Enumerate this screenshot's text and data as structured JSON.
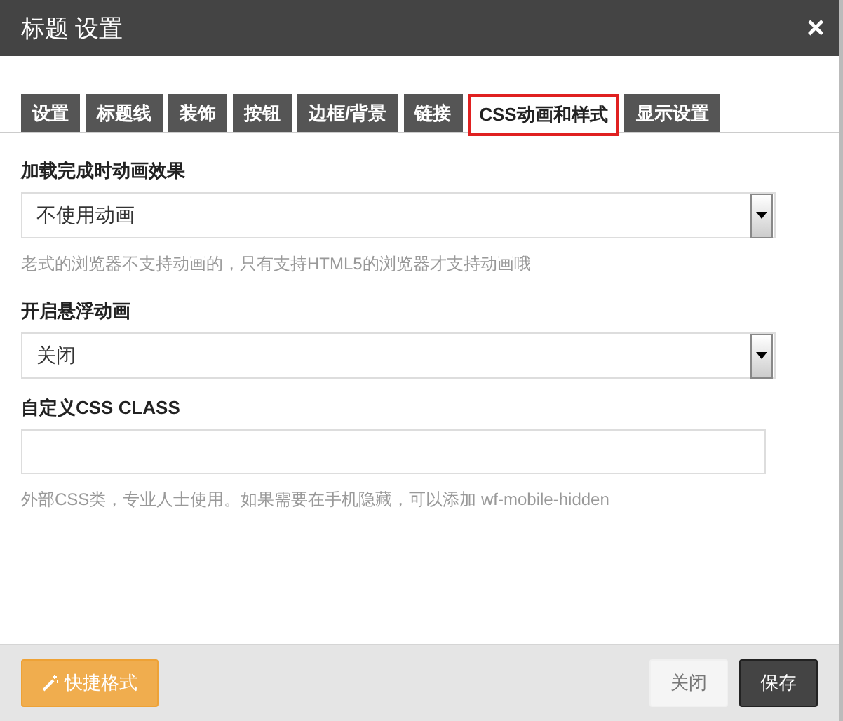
{
  "window": {
    "title": "标题 设置",
    "close": "×"
  },
  "tabs": [
    {
      "label": "设置",
      "selected": false
    },
    {
      "label": "标题线",
      "selected": false
    },
    {
      "label": "装饰",
      "selected": false
    },
    {
      "label": "按钮",
      "selected": false
    },
    {
      "label": "边框/背景",
      "selected": false
    },
    {
      "label": "链接",
      "selected": false
    },
    {
      "label": "CSS动画和样式",
      "selected": true
    },
    {
      "label": "显示设置",
      "selected": false
    }
  ],
  "fields": [
    {
      "kind": "select",
      "label": "加载完成时动画效果",
      "value": "不使用动画",
      "help": "老式的浏览器不支持动画的，只有支持HTML5的浏览器才支持动画哦"
    },
    {
      "kind": "select",
      "label": "开启悬浮动画",
      "value": "关闭"
    },
    {
      "kind": "text",
      "label": "自定义CSS CLASS",
      "help": "外部CSS类，专业人士使用。如果需要在手机隐藏，可以添加 wf-mobile-hidden"
    }
  ],
  "footer": {
    "quick_button": "快捷格式",
    "close_button": "关闭",
    "save_button": "保存"
  }
}
